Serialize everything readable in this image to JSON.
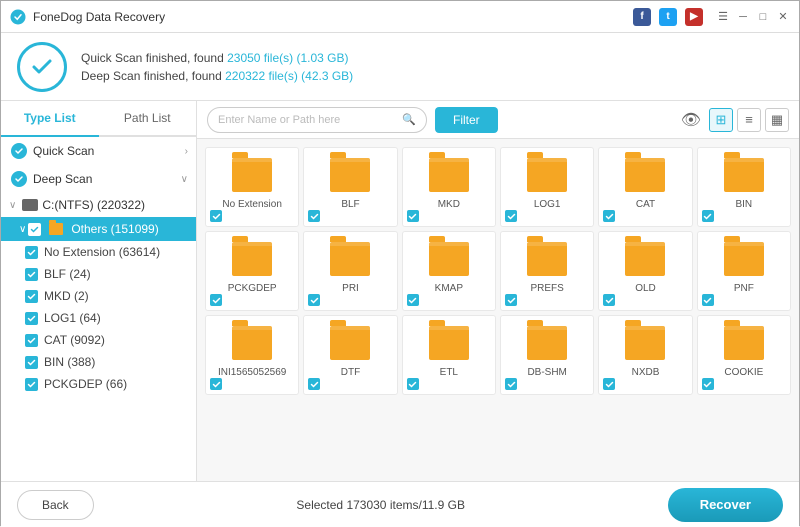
{
  "titleBar": {
    "title": "FoneDog Data Recovery",
    "controls": [
      "facebook",
      "twitter",
      "youtube",
      "menu",
      "minimize",
      "maximize",
      "close"
    ]
  },
  "scanStatus": {
    "quickScan": "Quick Scan finished, found 23050 file(s) (1.03 GB)",
    "deepScan": "Deep Scan finished, found 220322 file(s) (42.3 GB)",
    "quickHighlight": "23050 file(s) (1.03 GB)",
    "deepHighlight": "220322 file(s) (42.3 GB)"
  },
  "sidebar": {
    "tab1": "Type List",
    "tab2": "Path List",
    "quickScan": "Quick Scan",
    "deepScan": "Deep Scan",
    "drive": "C:(NTFS) (220322)",
    "others": "Others (151099)",
    "items": [
      {
        "label": "No Extension (63614)"
      },
      {
        "label": "BLF (24)"
      },
      {
        "label": "MKD (2)"
      },
      {
        "label": "LOG1 (64)"
      },
      {
        "label": "CAT (9092)"
      },
      {
        "label": "BIN (388)"
      },
      {
        "label": "PCKGDEP (66)"
      }
    ]
  },
  "toolbar": {
    "searchPlaceholder": "Enter Name or Path here",
    "filterLabel": "Filter"
  },
  "fileGrid": {
    "files": [
      {
        "label": "No Extension"
      },
      {
        "label": "BLF"
      },
      {
        "label": "MKD"
      },
      {
        "label": "LOG1"
      },
      {
        "label": "CAT"
      },
      {
        "label": "BIN"
      },
      {
        "label": "PCKGDEP"
      },
      {
        "label": "PRI"
      },
      {
        "label": "KMAP"
      },
      {
        "label": "PREFS"
      },
      {
        "label": "OLD"
      },
      {
        "label": "PNF"
      },
      {
        "label": "INI1565052569"
      },
      {
        "label": "DTF"
      },
      {
        "label": "ETL"
      },
      {
        "label": "DB-SHM"
      },
      {
        "label": "NXDB"
      },
      {
        "label": "COOKIE"
      }
    ]
  },
  "bottomBar": {
    "backLabel": "Back",
    "selectedInfo": "Selected 173030 items/11.9 GB",
    "recoverLabel": "Recover"
  }
}
